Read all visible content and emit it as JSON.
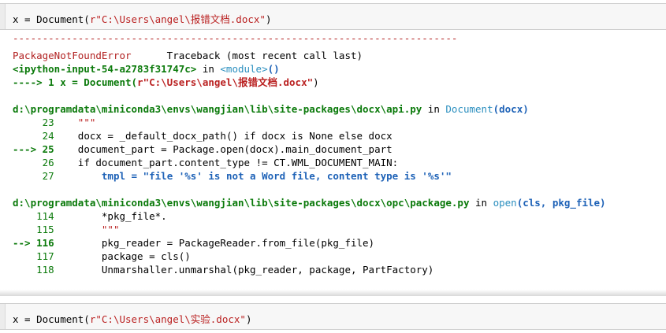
{
  "cell_top": {
    "prefix": "x = Document(",
    "str": "r\"C:\\Users\\angel\\报错文档.docx\"",
    "suffix": ")"
  },
  "traceback": {
    "separator": "---------------------------------------------------------------------------",
    "error_name": "PackageNotFoundError",
    "header_right": "Traceback (most recent call last)",
    "input_ref": "<ipython-input-54-a2783f31747c>",
    "in_word": " in ",
    "module": "<module>",
    "parens": "()",
    "arrow1": "----> 1 x = Document(",
    "arrow1_str": "r\"C:\\Users\\angel\\报错文档.docx\"",
    "arrow1_end": ")",
    "frame1": {
      "path": "d:\\programdata\\miniconda3\\envs\\wangjian\\lib\\site-packages\\docx\\api.py",
      "func": "Document",
      "args": "(docx)",
      "lines": [
        {
          "no": "23",
          "code": "    \"\"\""
        },
        {
          "no": "24",
          "code": "    docx = _default_docx_path() if docx is None else docx"
        },
        {
          "no": "25",
          "code": "    document_part = Package.open(docx).main_document_part",
          "arrow": "---> "
        },
        {
          "no": "26",
          "code": "    if document_part.content_type != CT.WML_DOCUMENT_MAIN:"
        },
        {
          "no": "27",
          "code": "        tmpl = \"file '%s' is not a Word file, content type is '%s'\""
        }
      ]
    },
    "frame2": {
      "path": "d:\\programdata\\miniconda3\\envs\\wangjian\\lib\\site-packages\\docx\\opc\\package.py",
      "func": "open",
      "args": "(cls, pkg_file)",
      "lines": [
        {
          "no": "114",
          "code": "        *pkg_file*."
        },
        {
          "no": "115",
          "code": "        \"\"\""
        },
        {
          "no": "116",
          "code": "        pkg_reader = PackageReader.from_file(pkg_file)",
          "arrow": "--> "
        },
        {
          "no": "117",
          "code": "        package = cls()"
        },
        {
          "no": "118",
          "code": "        Unmarshaller.unmarshal(pkg_reader, package, PartFactory)"
        }
      ]
    }
  },
  "cell_bottom": {
    "prefix": "x = Document(",
    "str": "r\"C:\\Users\\angel\\实验.docx\"",
    "suffix": ")"
  }
}
